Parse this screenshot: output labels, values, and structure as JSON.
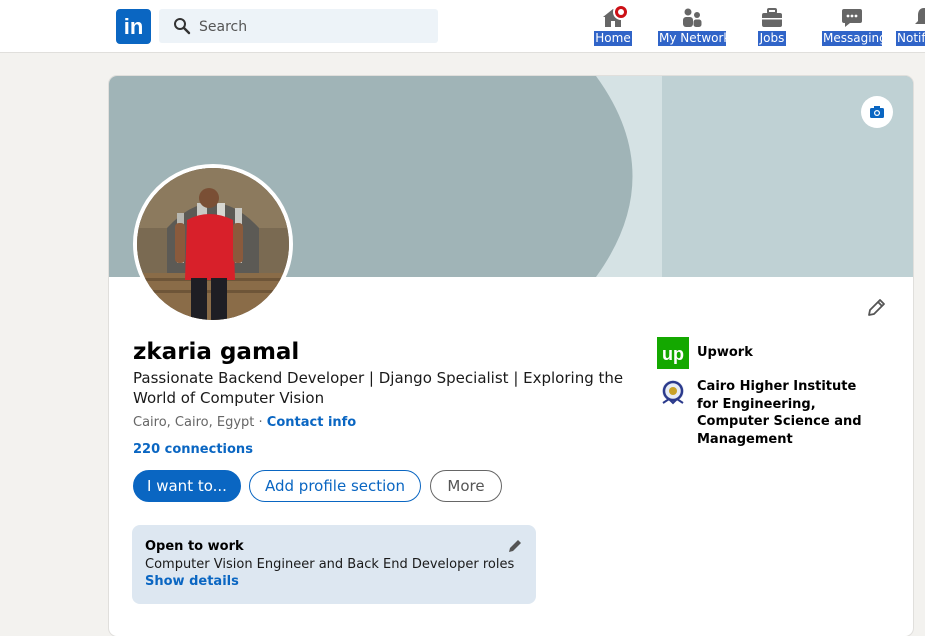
{
  "header": {
    "logo_text": "in",
    "search_placeholder": "Search",
    "nav": [
      {
        "label": "Home",
        "icon": "home-icon"
      },
      {
        "label": "My Network",
        "icon": "network-icon"
      },
      {
        "label": "Jobs",
        "icon": "briefcase-icon"
      },
      {
        "label": "Messaging",
        "icon": "chat-icon"
      },
      {
        "label": "Notif",
        "icon": "bell-icon"
      }
    ]
  },
  "profile": {
    "name": "zkaria gamal",
    "headline": "Passionate Backend Developer | Django Specialist | Exploring the World of Computer Vision",
    "location": "Cairo, Cairo, Egypt",
    "separator": " · ",
    "contact_label": "Contact info",
    "connections": "220 connections"
  },
  "actions": {
    "primary": "I want to...",
    "add_section": "Add profile section",
    "more": "More"
  },
  "open_to_work": {
    "title": "Open to work",
    "roles": "Computer Vision Engineer and Back End Developer roles",
    "link": "Show details"
  },
  "experience": {
    "company": "Upwork",
    "company_logo_text": "up",
    "school": "Cairo Higher Institute for Engineering, Computer Science and Management"
  },
  "colors": {
    "brand": "#0a66c2",
    "cover": "#a0b4b7",
    "cover_light": "#bfd1d4",
    "upwork": "#14a800",
    "open_to_work_bg": "#dde7f1"
  }
}
